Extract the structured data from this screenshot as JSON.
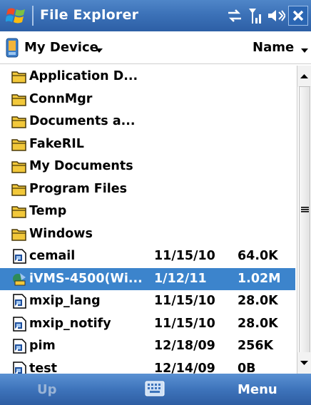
{
  "titlebar": {
    "app_title": "File Explorer",
    "icons": [
      "windows-start-icon",
      "connectivity-icon",
      "signal-strength-icon",
      "volume-icon",
      "close-icon"
    ]
  },
  "devicebar": {
    "location": "My Device",
    "sort_by": "Name"
  },
  "file_list": [
    {
      "icon": "folder-icon",
      "name": "Application D...",
      "date": "",
      "size": ""
    },
    {
      "icon": "folder-icon",
      "name": "ConnMgr",
      "date": "",
      "size": ""
    },
    {
      "icon": "folder-icon",
      "name": "Documents a...",
      "date": "",
      "size": ""
    },
    {
      "icon": "folder-icon",
      "name": "FakeRIL",
      "date": "",
      "size": ""
    },
    {
      "icon": "folder-icon",
      "name": "My Documents",
      "date": "",
      "size": ""
    },
    {
      "icon": "folder-icon",
      "name": "Program Files",
      "date": "",
      "size": ""
    },
    {
      "icon": "folder-icon",
      "name": "Temp",
      "date": "",
      "size": ""
    },
    {
      "icon": "folder-icon",
      "name": "Windows",
      "date": "",
      "size": ""
    },
    {
      "icon": "shortcut-icon",
      "name": "cemail",
      "date": "11/15/10",
      "size": "64.0K"
    },
    {
      "icon": "app-icon",
      "name": "iVMS-4500(Wi...",
      "date": "1/12/11",
      "size": "1.02M",
      "selected": true
    },
    {
      "icon": "shortcut-icon",
      "name": "mxip_lang",
      "date": "11/15/10",
      "size": "28.0K"
    },
    {
      "icon": "shortcut-icon",
      "name": "mxip_notify",
      "date": "11/15/10",
      "size": "28.0K"
    },
    {
      "icon": "shortcut-icon",
      "name": "pim",
      "date": "12/18/09",
      "size": "256K"
    },
    {
      "icon": "shortcut-icon",
      "name": "test",
      "date": "12/14/09",
      "size": "0B"
    }
  ],
  "softkeys": {
    "left": "Up",
    "center_icon": "keyboard-icon",
    "right": "Menu"
  },
  "colors": {
    "titlebar": "#3c72b8",
    "selection": "#3c84cc",
    "folder": "#f2c83a"
  }
}
